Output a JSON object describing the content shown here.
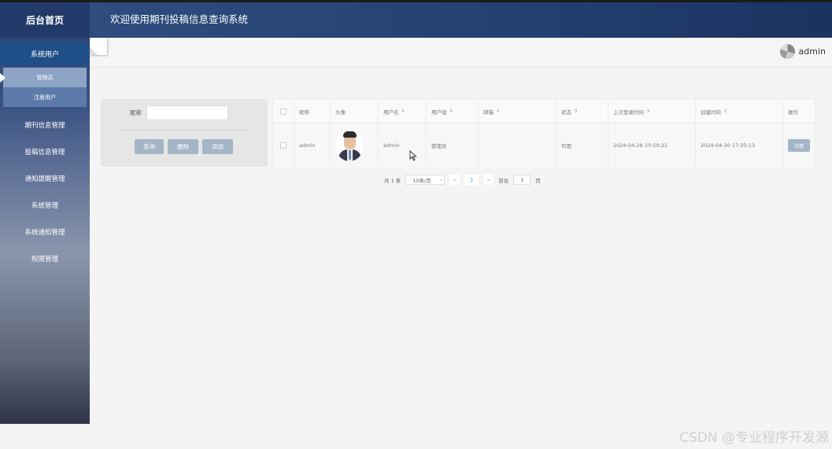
{
  "sidebar": {
    "home": "后台首页",
    "group": "系统用户",
    "sub_items": [
      {
        "label": "管理员"
      },
      {
        "label": "注册用户"
      }
    ],
    "items": [
      {
        "label": "期刊信息管理"
      },
      {
        "label": "投稿信息管理"
      },
      {
        "label": "通知提醒管理"
      },
      {
        "label": "系统管理"
      },
      {
        "label": "系统通知管理"
      },
      {
        "label": "权限管理"
      }
    ]
  },
  "header": {
    "title": "欢迎使用期刊投稿信息查询系统",
    "user": "admin"
  },
  "search": {
    "label": "昵称",
    "value": "",
    "buttons": {
      "query": "查询",
      "delete": "删除",
      "add": "添加"
    }
  },
  "table": {
    "headers": [
      "昵称",
      "头像",
      "用户名",
      "用户组",
      "邮箱",
      "状态",
      "上次登录时间",
      "创建时间",
      "操作"
    ],
    "sort_icon": "⇕",
    "rows": [
      {
        "nickname": "admin",
        "username": "admin",
        "group": "管理员",
        "email": "",
        "status": "可用",
        "last_login": "2024-04-28 10:50:21",
        "created": "2024-04-30 17:35:13",
        "action": "详情"
      }
    ]
  },
  "pager": {
    "total": "共 1 条",
    "page_size": "10条/页",
    "prev": "<",
    "current": "1",
    "next": ">",
    "goto_prefix": "前往",
    "goto_value": "1",
    "goto_suffix": "页"
  },
  "watermark": "CSDN @专业程序开发源"
}
